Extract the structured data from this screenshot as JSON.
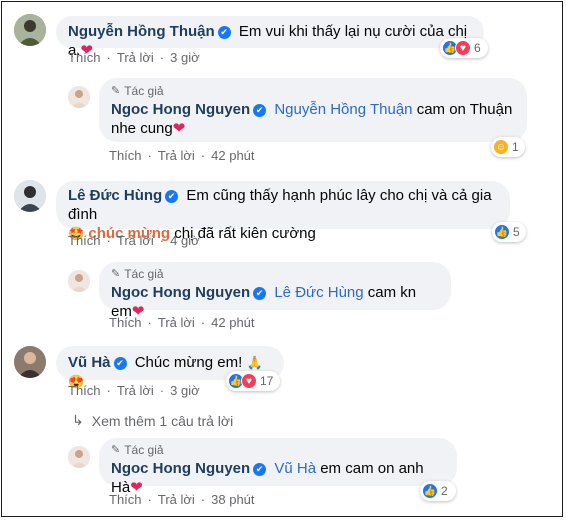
{
  "comments": [
    {
      "author": "Nguyễn Hồng Thuận",
      "text": "Em vui khi thấy lại nụ cười của chị ạ.",
      "like_label": "Thích",
      "reply_label": "Trả lời",
      "time": "3 giờ",
      "reaction_count": "6"
    },
    {
      "badge": "Tác giả",
      "author": "Ngoc Hong Nguyen",
      "mention": "Nguyễn Hồng Thuận",
      "text": "cam on Thuận nhe cung",
      "like_label": "Thích",
      "reply_label": "Trả lời",
      "time": "42 phút",
      "reaction_count": "1"
    },
    {
      "author": "Lê Đức Hùng",
      "text_part1": "Em cũng thấy hạnh phúc lây cho chị và cả gia đình",
      "highlight": "chúc mừng",
      "text_part2": "chị đã rất kiên cường",
      "like_label": "Thích",
      "reply_label": "Trả lời",
      "time": "4 giờ",
      "reaction_count": "5"
    },
    {
      "badge": "Tác giả",
      "author": "Ngoc Hong Nguyen",
      "mention": "Lê Đức Hùng",
      "text": "cam kn em",
      "like_label": "Thích",
      "reply_label": "Trả lời",
      "time": "42 phút"
    },
    {
      "author": "Vũ Hà",
      "text": "Chúc mừng em!",
      "like_label": "Thích",
      "reply_label": "Trả lời",
      "time": "3 giờ",
      "reaction_count": "17"
    },
    {
      "badge": "Tác giả",
      "author": "Ngoc Hong Nguyen",
      "mention": "Vũ Hà",
      "text": "em cam on anh Hà",
      "like_label": "Thích",
      "reply_label": "Trả lời",
      "time": "38 phút",
      "reaction_count": "2"
    }
  ],
  "more_replies": "Xem thêm 1 câu trả lời",
  "colors": {
    "like": "#1877f2",
    "love": "#f33e58",
    "name": "#1f3d5c",
    "mention": "#2d6ac7"
  }
}
